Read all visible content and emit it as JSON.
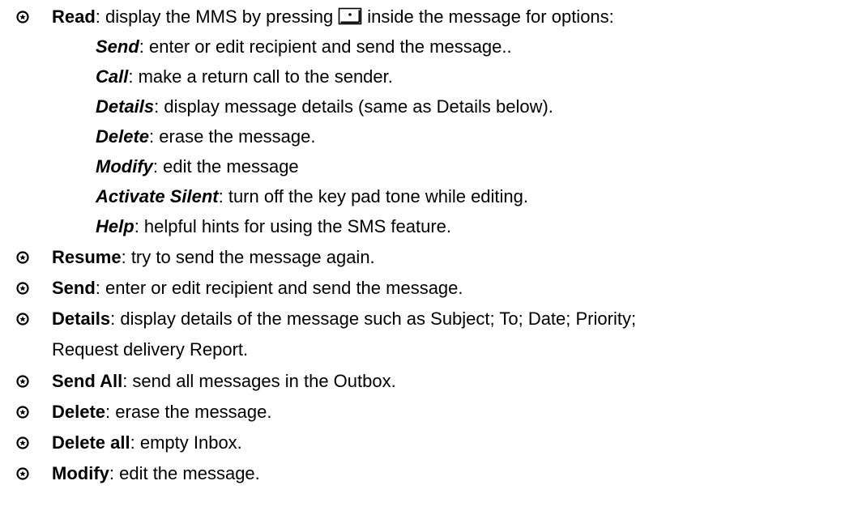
{
  "icons": {
    "bullet": "circled-star-bullet-icon",
    "inline": "center-key-icon"
  },
  "read_item": {
    "term": "Read",
    "before_icon": ": display the MMS by pressing",
    "after_icon": "inside the message for options:"
  },
  "read_options": [
    {
      "term": "Send",
      "desc": ": enter or edit recipient and send the message.."
    },
    {
      "term": "Call",
      "desc": ": make a return call to the sender."
    },
    {
      "term": "Details",
      "desc": ": display message details (same as Details below)."
    },
    {
      "term": "Delete",
      "desc": ": erase the message."
    },
    {
      "term": "Modify",
      "desc": ": edit the message"
    },
    {
      "term": "Activate Silent",
      "desc": ": turn off the key pad tone while editing."
    },
    {
      "term": "Help",
      "desc": ": helpful hints for using the SMS feature."
    }
  ],
  "items": [
    {
      "term": "Resume",
      "desc": ": try to send the message again."
    },
    {
      "term": "Send",
      "desc": ": enter or edit recipient and send the message."
    },
    {
      "term": "Details",
      "desc_line1": ": display details of the message such as Subject; To; Date; Priority;",
      "desc_line2": "Request delivery Report."
    },
    {
      "term": "Send All",
      "desc": ": send all messages in the Outbox."
    },
    {
      "term": "Delete",
      "desc": ": erase the message."
    },
    {
      "term": "Delete all",
      "desc": ": empty Inbox."
    },
    {
      "term": "Modify",
      "desc": ": edit the message."
    }
  ]
}
